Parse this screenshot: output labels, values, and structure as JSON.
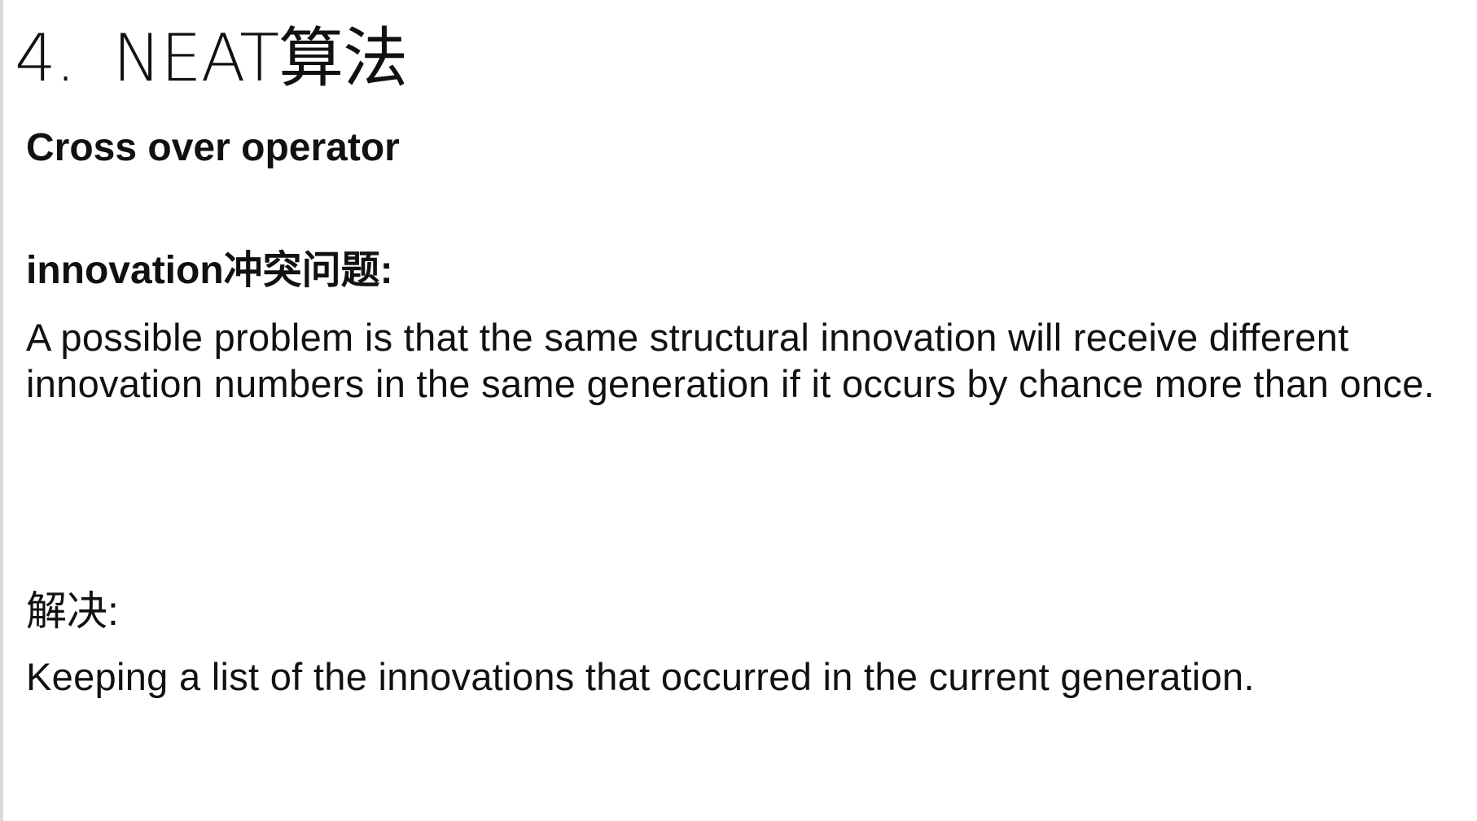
{
  "slide": {
    "title_number": "4.",
    "title_text": "NEAT算法",
    "subtitle": "Cross over operator",
    "problem": {
      "heading": "innovation冲突问题:",
      "text": "A possible problem is that the same structural innovation will receive different innovation numbers in the same generation if it occurs by chance more than once."
    },
    "solution": {
      "heading": "解决:",
      "text": "Keeping a list of the innovations that occurred in the current generation."
    }
  }
}
